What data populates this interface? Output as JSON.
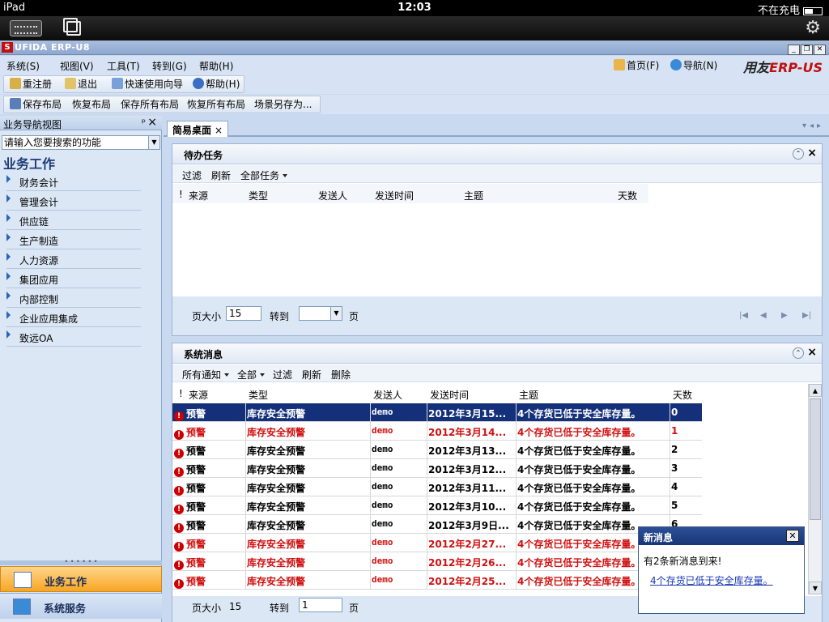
{
  "device": {
    "carrier": "iPad",
    "time": "12:03",
    "battery": "不在充电"
  },
  "app": {
    "title": "UFIDA ERP-U8",
    "logo": "S",
    "brand_a": "用友",
    "brand_b": "ERP-US"
  },
  "menu": {
    "items": [
      "系统(S)",
      "视图(V)",
      "工具(T)",
      "转到(G)",
      "帮助(H)"
    ],
    "home": "首页(F)",
    "nav": "导航(N)"
  },
  "toolbar1": [
    "重注册",
    "退出",
    "快速使用向导",
    "帮助(H)"
  ],
  "toolbar2": [
    "保存布局",
    "恢复布局",
    "保存所有布局",
    "恢复所有布局",
    "场景另存为..."
  ],
  "left": {
    "title": "业务导航视图",
    "search_placeholder": "请输入您要搜索的功能",
    "section": "业务工作",
    "items": [
      "财务会计",
      "管理会计",
      "供应链",
      "生产制造",
      "人力资源",
      "集团应用",
      "内部控制",
      "企业应用集成",
      "致远OA"
    ],
    "bottom_tabs": [
      "业务工作",
      "系统服务"
    ]
  },
  "doc_tab": "简易桌面",
  "tasks": {
    "title": "待办任务",
    "tools": [
      "过滤",
      "刷新",
      "全部任务"
    ],
    "columns": [
      "!",
      "来源",
      "类型",
      "发送人",
      "发送时间",
      "主题",
      "天数"
    ],
    "page_size_label": "页大小",
    "page_size": "15",
    "goto_label": "转到",
    "page_suffix": "页"
  },
  "messages": {
    "title": "系统消息",
    "tools": [
      "所有通知",
      "全部",
      "过滤",
      "刷新",
      "删除"
    ],
    "columns": [
      "!",
      "来源",
      "类型",
      "发送人",
      "发送时间",
      "主题",
      "天数"
    ],
    "rows": [
      {
        "source": "预警",
        "type": "库存安全预警",
        "sender": "demo",
        "time": "2012年3月15...",
        "subject": "4个存货已低于安全库存量。",
        "days": "0",
        "state": "selected"
      },
      {
        "source": "预警",
        "type": "库存安全预警",
        "sender": "demo",
        "time": "2012年3月14...",
        "subject": "4个存货已低于安全库存量。",
        "days": "1",
        "state": "red"
      },
      {
        "source": "预警",
        "type": "库存安全预警",
        "sender": "demo",
        "time": "2012年3月13...",
        "subject": "4个存货已低于安全库存量。",
        "days": "2",
        "state": "normal"
      },
      {
        "source": "预警",
        "type": "库存安全预警",
        "sender": "demo",
        "time": "2012年3月12...",
        "subject": "4个存货已低于安全库存量。",
        "days": "3",
        "state": "normal"
      },
      {
        "source": "预警",
        "type": "库存安全预警",
        "sender": "demo",
        "time": "2012年3月11...",
        "subject": "4个存货已低于安全库存量。",
        "days": "4",
        "state": "normal"
      },
      {
        "source": "预警",
        "type": "库存安全预警",
        "sender": "demo",
        "time": "2012年3月10...",
        "subject": "4个存货已低于安全库存量。",
        "days": "5",
        "state": "normal"
      },
      {
        "source": "预警",
        "type": "库存安全预警",
        "sender": "demo",
        "time": "2012年3月9日...",
        "subject": "4个存货已低于安全库存量。",
        "days": "6",
        "state": "normal"
      },
      {
        "source": "预警",
        "type": "库存安全预警",
        "sender": "demo",
        "time": "2012年2月27...",
        "subject": "4个存货已低于安全库存量。",
        "days": "",
        "state": "red"
      },
      {
        "source": "预警",
        "type": "库存安全预警",
        "sender": "demo",
        "time": "2012年2月26...",
        "subject": "4个存货已低于安全库存量。",
        "days": "",
        "state": "red"
      },
      {
        "source": "预警",
        "type": "库存安全预警",
        "sender": "demo",
        "time": "2012年2月25...",
        "subject": "4个存货已低于安全库存量。",
        "days": "",
        "state": "red"
      }
    ],
    "page_size_label": "页大小",
    "page_size": "15",
    "goto_label": "转到",
    "goto_value": "1",
    "page_suffix": "页"
  },
  "popup": {
    "title": "新消息",
    "line": "有2条新消息到来!",
    "link": "4个存货已低于安全库存量。"
  }
}
